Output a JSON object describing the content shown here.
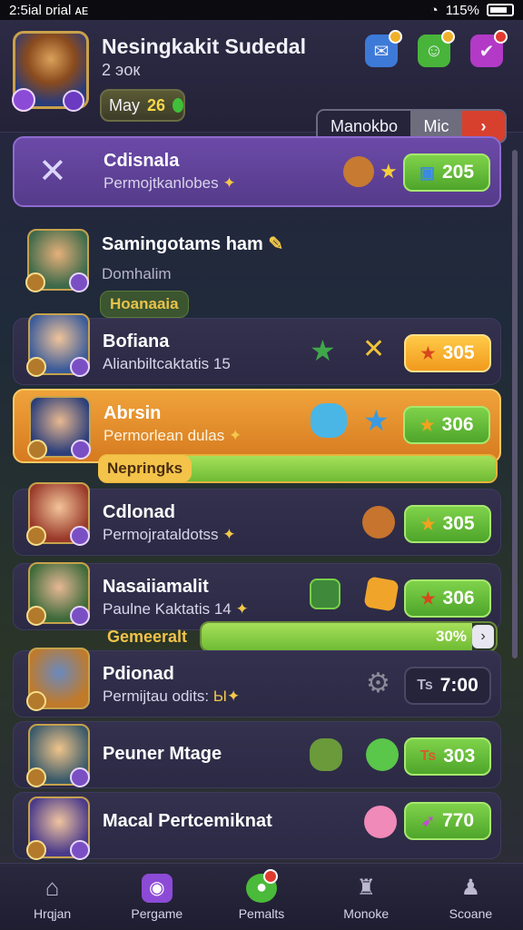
{
  "status": {
    "time": "2:5ial ᴅrial ᴀᴇ",
    "battery": "115%"
  },
  "header": {
    "player_name": "Nesingkakit Sudedal",
    "player_sub": "2 эок",
    "month_label": "May",
    "month_value": "26",
    "segments": [
      "Manokbo",
      "Mic",
      "›"
    ]
  },
  "rows": [
    {
      "title": "Cdisnala",
      "sub": "Permojtkanlobes",
      "score": "205",
      "style": "purple"
    },
    {
      "title": "Samingotams ham",
      "sub": "Domhalim",
      "tag": "Hoanaaia",
      "style": "plain"
    },
    {
      "title": "Bofiana",
      "sub": "Alianbiltcaktatis 15",
      "score": "305",
      "style": "gold"
    },
    {
      "title": "Abrsin",
      "sub": "Permorlean dulas",
      "score": "306",
      "tag": "Nepringks",
      "style": "orange"
    },
    {
      "title": "Cdlonad",
      "sub": "Permojrataldotss",
      "score": "305",
      "style": "green"
    },
    {
      "title": "Nasaiiamalit",
      "sub": "Paulne Kaktatis 14",
      "score": "306",
      "tag": "Gemeeralt",
      "progress": "30%",
      "style": "green"
    },
    {
      "title": "Pdionad",
      "sub": "Permijtau odits:",
      "sub_suffix": "Ы",
      "score": "7:00",
      "score_icon": "Ts",
      "style": "dark"
    },
    {
      "title": "Peuner Mtage",
      "score": "303",
      "score_icon": "Ts",
      "style": "green"
    },
    {
      "title": "Macal Pertcemiknat",
      "score": "770",
      "style": "green"
    }
  ],
  "nav": [
    "Hrqjan",
    "Pergame",
    "Pemalts",
    "Monoke",
    "Scoane"
  ],
  "colors": {
    "accent_purple": "#6b4aa8",
    "accent_orange": "#f0a33a",
    "accent_green": "#6fbb34",
    "alert_red": "#d8402e"
  }
}
